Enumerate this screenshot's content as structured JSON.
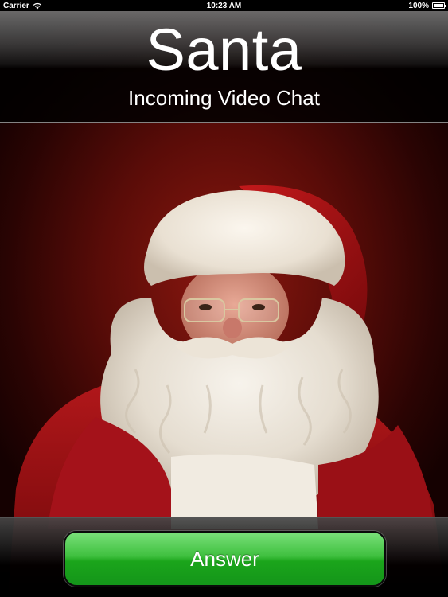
{
  "status_bar": {
    "carrier": "Carrier",
    "time": "10:23 AM",
    "battery": "100%",
    "battery_level": 1.0
  },
  "call": {
    "caller_name": "Santa",
    "status": "Incoming Video Chat"
  },
  "actions": {
    "answer_label": "Answer"
  },
  "colors": {
    "answer_green": "#2fb52f",
    "background_red": "#8c1810"
  },
  "icons": [
    "wifi-icon",
    "battery-icon"
  ]
}
